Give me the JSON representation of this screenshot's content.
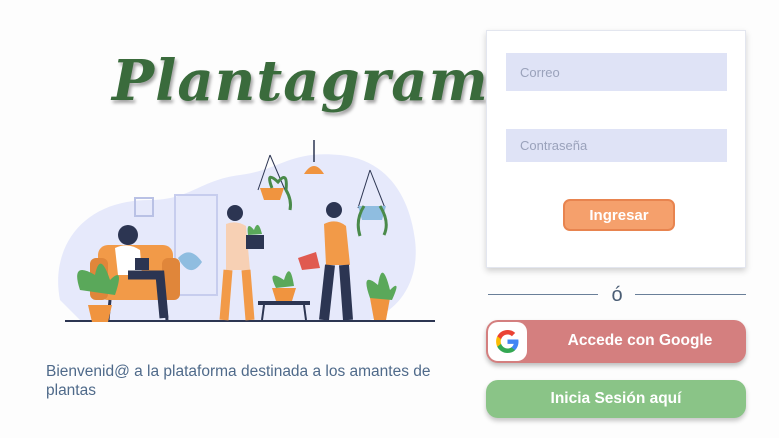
{
  "brand": {
    "name": "Plantagram"
  },
  "welcome_text": "Bienvenid@ a la plataforma destinada a los amantes de plantas",
  "login": {
    "email_placeholder": "Correo",
    "password_placeholder": "Contraseña",
    "submit_label": "Ingresar"
  },
  "divider_text": "ó",
  "google_button": {
    "label": "Accede con Google"
  },
  "session_button": {
    "label": "Inicia Sesión aquí"
  },
  "colors": {
    "brand_green": "#3a6b3c",
    "input_bg": "#dfe3f6",
    "submit_orange": "#f5a06c",
    "google_red": "#d47f7f",
    "session_green": "#8ac487"
  }
}
